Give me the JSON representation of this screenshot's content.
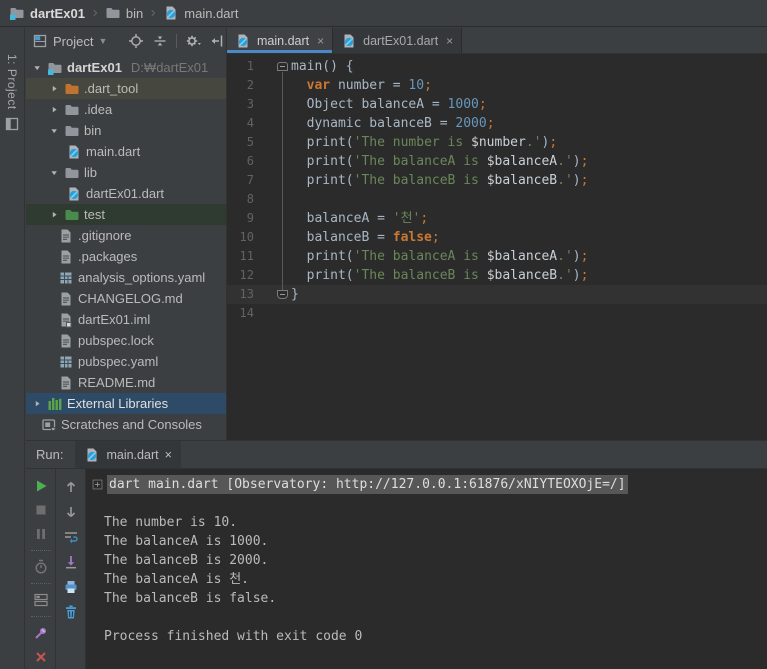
{
  "colors": {
    "editor_bg": "#2b2b2b",
    "panel_bg": "#3c3f41",
    "selection_blue": "#2d4a66",
    "tab_underline": "#4a88c7",
    "keyword": "#cc7832",
    "number": "#6897bb",
    "string": "#6a8759",
    "plain_code": "#a9b7c6",
    "run_green": "#4caf50",
    "close_red": "#c75450",
    "icon_blue": "#4b9cd3",
    "pin_purple": "#a779c7"
  },
  "nav": {
    "breadcrumbs": [
      {
        "label": "dartEx01",
        "icon": "project-folder"
      },
      {
        "label": "bin",
        "icon": "folder"
      },
      {
        "label": "main.dart",
        "icon": "dart"
      }
    ]
  },
  "tool_stripe": {
    "project_button_label": "1: Project"
  },
  "project_panel": {
    "title": "Project",
    "caret": "▾",
    "toolbar": [
      "locate",
      "collapse-all",
      "divider",
      "gear",
      "hide-panel"
    ],
    "tree": [
      {
        "label": "dartEx01",
        "suffix": "D:₩dartEx01",
        "icon": "project-folder",
        "arrow": "exp",
        "level": 0,
        "bold": true
      },
      {
        "label": ".dart_tool",
        "icon": "folder-excluded",
        "arrow": "col",
        "level": 1,
        "row": "hover"
      },
      {
        "label": ".idea",
        "icon": "folder",
        "arrow": "col",
        "level": 1
      },
      {
        "label": "bin",
        "icon": "folder",
        "arrow": "exp",
        "level": 1
      },
      {
        "label": "main.dart",
        "icon": "dart",
        "arrow": "none",
        "level": 2
      },
      {
        "label": "lib",
        "icon": "folder",
        "arrow": "exp",
        "level": 1
      },
      {
        "label": "dartEx01.dart",
        "icon": "dart",
        "arrow": "none",
        "level": 2
      },
      {
        "label": "test",
        "icon": "folder-test",
        "arrow": "col",
        "level": 1,
        "row": "test"
      },
      {
        "label": ".gitignore",
        "icon": "file-text",
        "arrow": "none",
        "level": 1,
        "extra": true
      },
      {
        "label": ".packages",
        "icon": "file-text",
        "arrow": "none",
        "level": 1,
        "extra": true
      },
      {
        "label": "analysis_options.yaml",
        "icon": "file-yaml",
        "arrow": "none",
        "level": 1,
        "extra": true
      },
      {
        "label": "CHANGELOG.md",
        "icon": "file-text",
        "arrow": "none",
        "level": 1,
        "extra": true
      },
      {
        "label": "dartEx01.iml",
        "icon": "file-iml",
        "arrow": "none",
        "level": 1,
        "extra": true
      },
      {
        "label": "pubspec.lock",
        "icon": "file-text",
        "arrow": "none",
        "level": 1,
        "extra": true
      },
      {
        "label": "pubspec.yaml",
        "icon": "file-yaml",
        "arrow": "none",
        "level": 1,
        "extra": true
      },
      {
        "label": "README.md",
        "icon": "file-text",
        "arrow": "none",
        "level": 1,
        "extra": true
      },
      {
        "label": "External Libraries",
        "icon": "external-libs",
        "arrow": "col",
        "level": 0,
        "row": "selected"
      },
      {
        "label": "Scratches and Consoles",
        "icon": "scratches",
        "arrow": "none",
        "level": 0,
        "extra": true
      }
    ]
  },
  "editor": {
    "tabs": [
      {
        "label": "main.dart",
        "icon": "dart",
        "close": "×",
        "active": true
      },
      {
        "label": "dartEx01.dart",
        "icon": "dart",
        "close": "×",
        "active": false
      }
    ],
    "lines": [
      {
        "n": "1",
        "fold": "start",
        "tokens": [
          [
            "plain",
            "main() {"
          ]
        ]
      },
      {
        "n": "2",
        "tokens": [
          [
            "plain",
            "  "
          ],
          [
            "kw",
            "var"
          ],
          [
            "plain",
            " number = "
          ],
          [
            "num",
            "10"
          ],
          [
            "semi",
            ";"
          ]
        ]
      },
      {
        "n": "3",
        "tokens": [
          [
            "plain",
            "  Object balanceA = "
          ],
          [
            "num",
            "1000"
          ],
          [
            "semi",
            ";"
          ]
        ]
      },
      {
        "n": "4",
        "tokens": [
          [
            "plain",
            "  dynamic balanceB = "
          ],
          [
            "num",
            "2000"
          ],
          [
            "semi",
            ";"
          ]
        ]
      },
      {
        "n": "5",
        "tokens": [
          [
            "plain",
            "  print("
          ],
          [
            "str",
            "'The number is "
          ],
          [
            "interp",
            "$number"
          ],
          [
            "str",
            ".'"
          ],
          [
            "plain",
            ")"
          ],
          [
            "semi",
            ";"
          ]
        ]
      },
      {
        "n": "6",
        "tokens": [
          [
            "plain",
            "  print("
          ],
          [
            "str",
            "'The balanceA is "
          ],
          [
            "interp",
            "$balanceA"
          ],
          [
            "str",
            ".'"
          ],
          [
            "plain",
            ")"
          ],
          [
            "semi",
            ";"
          ]
        ]
      },
      {
        "n": "7",
        "tokens": [
          [
            "plain",
            "  print("
          ],
          [
            "str",
            "'The balanceB is "
          ],
          [
            "interp",
            "$balanceB"
          ],
          [
            "str",
            ".'"
          ],
          [
            "plain",
            ")"
          ],
          [
            "semi",
            ";"
          ]
        ]
      },
      {
        "n": "8",
        "tokens": []
      },
      {
        "n": "9",
        "tokens": [
          [
            "plain",
            "  balanceA = "
          ],
          [
            "str",
            "'천'"
          ],
          [
            "semi",
            ";"
          ]
        ]
      },
      {
        "n": "10",
        "tokens": [
          [
            "plain",
            "  balanceB = "
          ],
          [
            "kw",
            "false"
          ],
          [
            "semi",
            ";"
          ]
        ]
      },
      {
        "n": "11",
        "tokens": [
          [
            "plain",
            "  print("
          ],
          [
            "str",
            "'The balanceA is "
          ],
          [
            "interp",
            "$balanceA"
          ],
          [
            "str",
            ".'"
          ],
          [
            "plain",
            ")"
          ],
          [
            "semi",
            ";"
          ]
        ]
      },
      {
        "n": "12",
        "tokens": [
          [
            "plain",
            "  print("
          ],
          [
            "str",
            "'The balanceB is "
          ],
          [
            "interp",
            "$balanceB"
          ],
          [
            "str",
            ".'"
          ],
          [
            "plain",
            ")"
          ],
          [
            "semi",
            ";"
          ]
        ]
      },
      {
        "n": "13",
        "fold": "end",
        "current": true,
        "tokens": [
          [
            "plain",
            "}"
          ]
        ]
      },
      {
        "n": "14",
        "tokens": []
      }
    ]
  },
  "run_panel": {
    "label": "Run:",
    "tab": {
      "label": "main.dart",
      "icon": "dart",
      "close": "×"
    },
    "toolbar_main": [
      "rerun",
      "stop",
      "pause",
      "sep",
      "timer",
      "sep",
      "layout",
      "sep",
      "pin",
      "close-x"
    ],
    "toolbar_console": [
      "up",
      "down",
      "softwrap",
      "scroll-end",
      "print",
      "clear"
    ],
    "console": [
      {
        "type": "cmd",
        "text": "dart main.dart [Observatory: http://127.0.0.1:61876/xNIYTEOXOjE=/]"
      },
      {
        "type": "blank",
        "text": ""
      },
      {
        "type": "out",
        "text": "The number is 10."
      },
      {
        "type": "out",
        "text": "The balanceA is 1000."
      },
      {
        "type": "out",
        "text": "The balanceB is 2000."
      },
      {
        "type": "out",
        "text": "The balanceA is 천."
      },
      {
        "type": "out",
        "text": "The balanceB is false."
      },
      {
        "type": "blank",
        "text": ""
      },
      {
        "type": "out",
        "text": "Process finished with exit code 0"
      }
    ]
  }
}
